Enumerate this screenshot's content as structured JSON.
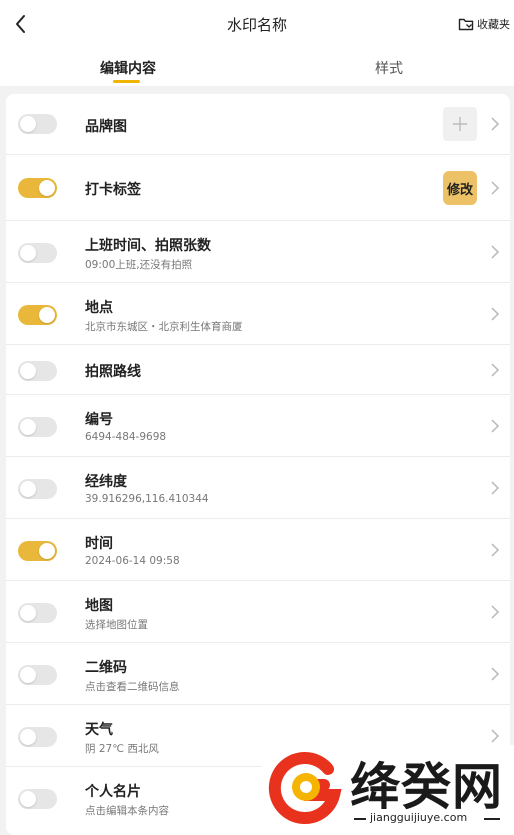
{
  "header": {
    "title": "水印名称",
    "favorites_label": "收藏夹"
  },
  "tabs": [
    {
      "label": "编辑内容",
      "active": true
    },
    {
      "label": "样式",
      "active": false
    }
  ],
  "rows": [
    {
      "id": "brand-image",
      "label": "品牌图",
      "enabled": false,
      "control": "plus"
    },
    {
      "id": "checkin-tag",
      "label": "打卡标签",
      "enabled": true,
      "control": "edit",
      "control_label": "修改"
    },
    {
      "id": "work-time",
      "label": "上班时间、拍照张数",
      "sub": "09:00上班,还没有拍照",
      "enabled": false
    },
    {
      "id": "location",
      "label": "地点",
      "sub": "北京市东城区・北京利生体育商厦",
      "enabled": true
    },
    {
      "id": "photo-route",
      "label": "拍照路线",
      "enabled": false
    },
    {
      "id": "number",
      "label": "编号",
      "sub": "6494-484-9698",
      "enabled": false
    },
    {
      "id": "coordinates",
      "label": "经纬度",
      "sub": "39.916296,116.410344",
      "enabled": false
    },
    {
      "id": "time",
      "label": "时间",
      "sub": "2024-06-14 09:58",
      "enabled": true
    },
    {
      "id": "map",
      "label": "地图",
      "sub": "选择地图位置",
      "enabled": false
    },
    {
      "id": "qrcode",
      "label": "二维码",
      "sub": "点击查看二维码信息",
      "enabled": false
    },
    {
      "id": "weather",
      "label": "天气",
      "sub": "阴 27℃ 西北风",
      "enabled": false
    },
    {
      "id": "business-card",
      "label": "个人名片",
      "sub": "点击编辑本条内容",
      "enabled": false
    }
  ],
  "watermark": {
    "brand": "绛癸网",
    "url": "jiangguijiuye.com"
  },
  "colors": {
    "accent": "#e9b83b",
    "edit_button": "#edc266",
    "toggle_off": "#e6e6e6",
    "background": "#f2f2f2"
  },
  "icons": {
    "back": "chevron-left-icon",
    "favorites": "folder-icon",
    "row_arrow": "chevron-right-icon",
    "add": "plus-icon",
    "logo": "g-logo-icon"
  }
}
